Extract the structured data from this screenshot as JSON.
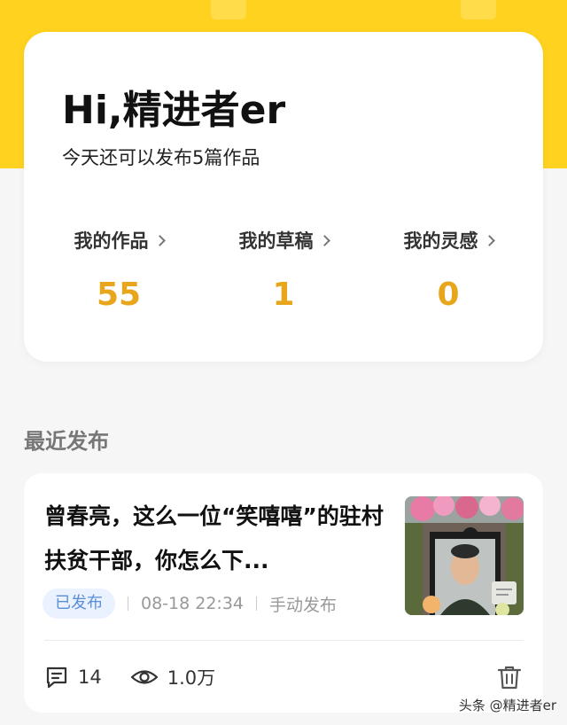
{
  "header": {
    "greeting": "Hi,精进者er",
    "quota": "今天还可以发布5篇作品"
  },
  "stats": [
    {
      "label": "我的作品",
      "value": "55"
    },
    {
      "label": "我的草稿",
      "value": "1"
    },
    {
      "label": "我的灵感",
      "value": "0"
    }
  ],
  "recent": {
    "title": "最近发布",
    "post": {
      "title": "曾春亮，这么一位“笑嘻嘻”的驻村扶贫干部，你怎么下...",
      "status": "已发布",
      "time": "08-18 22:34",
      "mode": "手动发布",
      "comments": "14",
      "views": "1.0万"
    }
  },
  "watermark": "头条 @精进者er",
  "colors": {
    "brand_yellow": "#ffd21f",
    "stat_value": "#e8a61c",
    "badge_text": "#5a8fd8",
    "badge_bg": "#eaf2ff"
  },
  "icons": [
    "chevron-right-icon",
    "comment-icon",
    "eye-icon",
    "trash-icon"
  ]
}
